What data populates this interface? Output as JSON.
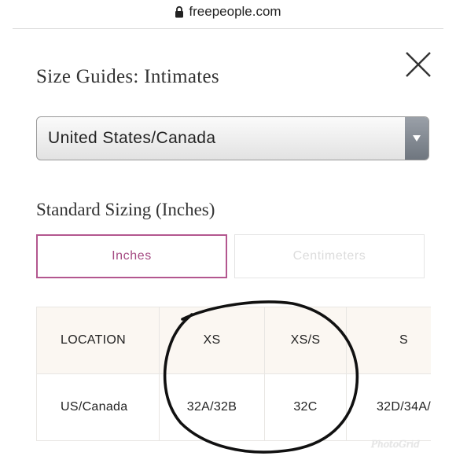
{
  "browser": {
    "url": "freepeople.com",
    "lock_icon": "lock-icon"
  },
  "modal": {
    "title": "Size Guides: Intimates",
    "close_icon": "close-icon"
  },
  "region_select": {
    "selected": "United States/Canada",
    "arrow_icon": "triangle-down-icon"
  },
  "section": {
    "title": "Standard Sizing (Inches)"
  },
  "unit_tabs": [
    {
      "label": "Inches",
      "active": true
    },
    {
      "label": "Centimeters",
      "active": false
    }
  ],
  "size_table": {
    "header": [
      "LOCATION",
      "XS",
      "XS/S",
      "S"
    ],
    "rows": [
      [
        "US/Canada",
        "32A/32B",
        "32C",
        "32D/34A/"
      ]
    ]
  },
  "watermark": "PhotoGrid",
  "colors": {
    "accent": "#b3578f",
    "header_bg": "#fbf7f2",
    "annotation": "#111111"
  }
}
